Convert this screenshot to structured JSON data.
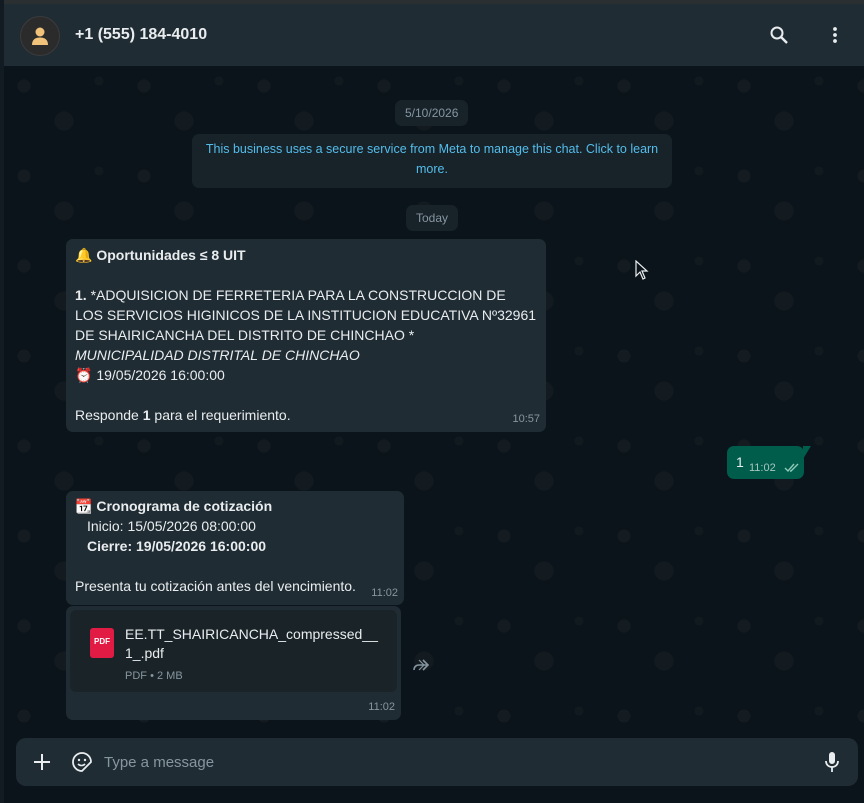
{
  "header": {
    "contact_name": "+1 (555) 184-4010"
  },
  "chat": {
    "date_pill": "5/10/2026",
    "today_pill": "Today",
    "meta_notice": "This business uses a secure service from Meta to manage this chat. Click to learn more.",
    "messages": [
      {
        "direction": "incoming",
        "title_emoji": "🔔",
        "title": "Oportunidades ≤ 8 UIT",
        "item_number": "1.",
        "item_text": "*ADQUISICION DE FERRETERIA PARA LA CONSTRUCCION DE LOS SERVICIOS HIGINICOS DE LA INSTITUCION EDUCATIVA Nº32961 DE SHAIRICANCHA DEL DISTRITO DE CHINCHAO *",
        "entity": "MUNICIPALIDAD DISTRITAL DE CHINCHAO",
        "deadline_emoji": "⏰",
        "deadline": "19/05/2026 16:00:00",
        "reply_prefix": "Responde ",
        "reply_number": "1",
        "reply_suffix": " para el requerimiento.",
        "time": "10:57"
      },
      {
        "direction": "outgoing",
        "text": "1",
        "time": "11:02",
        "status": "read"
      },
      {
        "direction": "incoming",
        "title_emoji": "📆",
        "title": "Cronograma de cotización",
        "start_label": "Inicio: 15/05/2026 08:00:00",
        "close_label": "Cierre: 19/05/2026 16:00:00",
        "footer_text": "Presenta tu cotización antes del vencimiento.",
        "time": "11:02"
      },
      {
        "direction": "incoming",
        "type": "document",
        "icon_label": "PDF",
        "filename": "EE.TT_SHAIRICANCHA_compressed__1_.pdf",
        "filetype": "PDF",
        "separator": "•",
        "filesize": "2 MB",
        "time": "11:02"
      }
    ]
  },
  "composer": {
    "placeholder": "Type a message"
  },
  "colors": {
    "background": "#0b141a",
    "header": "#202c33",
    "incoming_bubble": "#202c33",
    "outgoing_bubble": "#005c4b",
    "link": "#53bdeb",
    "read_ticks": "#8ecab8",
    "pdf_red": "#e21b44"
  }
}
